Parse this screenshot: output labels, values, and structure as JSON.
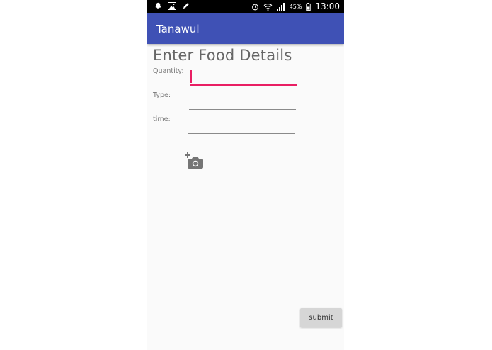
{
  "status_bar": {
    "icons": [
      "snapchat-icon",
      "image-icon",
      "pencil-icon",
      "alarm-icon",
      "wifi-icon",
      "signal-icon",
      "battery-icon"
    ],
    "battery": "45%",
    "time": "13:00"
  },
  "app_bar": {
    "title": "Tanawul",
    "color": "#3f51b5"
  },
  "form": {
    "heading": "Enter Food Details",
    "fields": [
      {
        "label": "Quantity:",
        "value": ""
      },
      {
        "label": "Type:",
        "value": ""
      },
      {
        "label": "time:",
        "value": ""
      }
    ],
    "add_photo_icon": "add-photo-icon",
    "submit_label": "submit"
  },
  "colors": {
    "accent": "#e91e63",
    "primary": "#3f51b5"
  }
}
